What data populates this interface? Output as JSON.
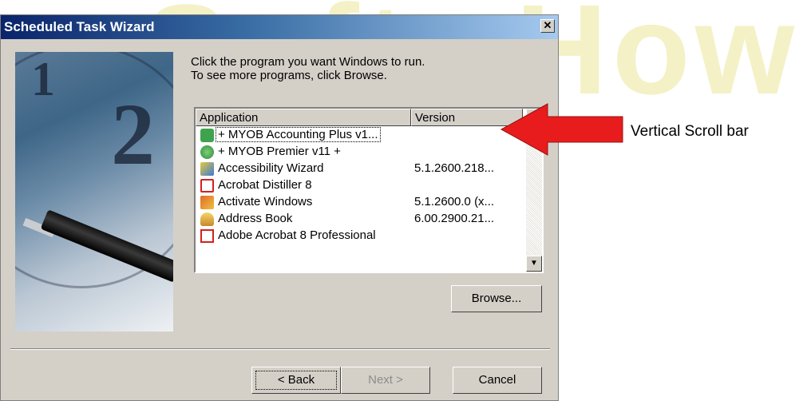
{
  "watermark": {
    "text": "SoftwHow"
  },
  "dialog": {
    "title": "Scheduled Task Wizard",
    "close_label": "✕",
    "instruction_line1": "Click the program you want Windows to run.",
    "instruction_line2": "To see more programs, click Browse."
  },
  "list": {
    "columns": [
      "Application",
      "Version"
    ],
    "rows": [
      {
        "name": "+ MYOB Accounting Plus v1...",
        "version": "",
        "icon": "myob-accounting-icon",
        "selected": true
      },
      {
        "name": "+ MYOB Premier v11 +",
        "version": "",
        "icon": "myob-premier-icon",
        "selected": false
      },
      {
        "name": "Accessibility Wizard",
        "version": "5.1.2600.218...",
        "icon": "accessibility-wizard-icon",
        "selected": false
      },
      {
        "name": "Acrobat Distiller 8",
        "version": "",
        "icon": "acrobat-distiller-icon",
        "selected": false
      },
      {
        "name": "Activate Windows",
        "version": "5.1.2600.0 (x...",
        "icon": "activate-windows-icon",
        "selected": false
      },
      {
        "name": "Address Book",
        "version": "6.00.2900.21...",
        "icon": "address-book-icon",
        "selected": false
      },
      {
        "name": "Adobe Acrobat 8 Professional",
        "version": "",
        "icon": "adobe-acrobat-icon",
        "selected": false
      }
    ]
  },
  "buttons": {
    "browse": "Browse...",
    "back": "< Back",
    "next": "Next >",
    "cancel": "Cancel"
  },
  "annotation": {
    "label": "Vertical Scroll bar",
    "arrow_color": "#e81c1c"
  }
}
